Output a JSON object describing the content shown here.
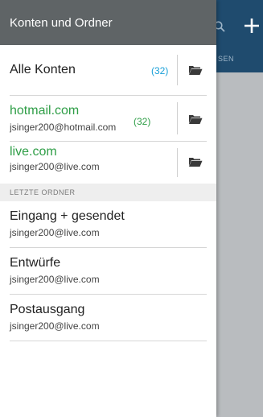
{
  "background": {
    "tab_fragment": "SEN",
    "icons": [
      "search-icon",
      "plus-icon"
    ]
  },
  "drawer": {
    "title": "Konten und Ordner",
    "accounts": [
      {
        "title": "Alle Konten",
        "count": "(32)",
        "icon": "folder-icon"
      },
      {
        "title": "hotmail.com",
        "email": "jsinger200@hotmail.com",
        "count": "(32)",
        "icon": "folder-icon"
      },
      {
        "title": "live.com",
        "email": "jsinger200@live.com",
        "icon": "folder-icon"
      }
    ],
    "recent_section_label": "LETZTE ORDNER",
    "recent_folders": [
      {
        "title": "Eingang + gesendet",
        "email": "jsinger200@live.com"
      },
      {
        "title": "Entwürfe",
        "email": "jsinger200@live.com"
      },
      {
        "title": "Postausgang",
        "email": "jsinger200@live.com"
      }
    ]
  },
  "colors": {
    "header_bg": "#5f6466",
    "app_toolbar": "#1f4b6e",
    "account_green": "#2f9e47",
    "count_blue": "#1aa0d8",
    "scrim": "#b9bcbf"
  }
}
